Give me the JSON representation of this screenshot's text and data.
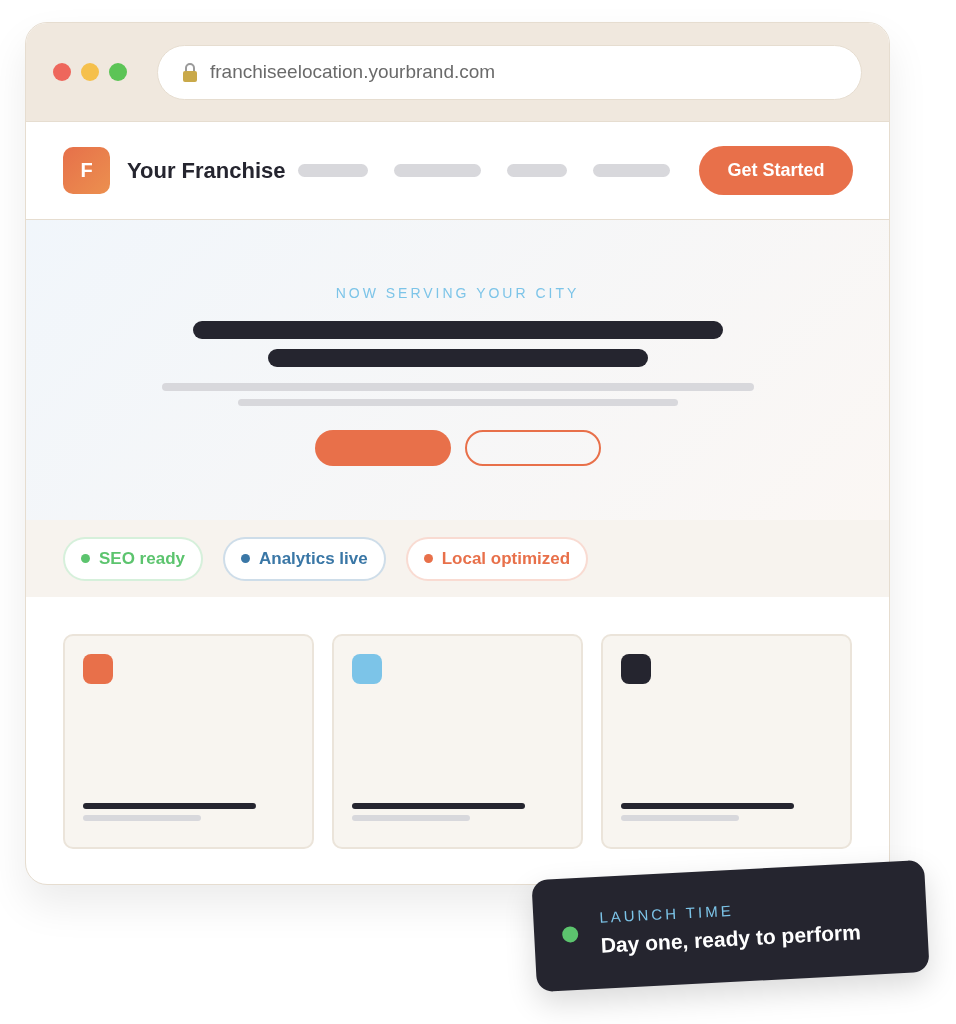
{
  "window": {
    "url": "franchiseelocation.yourbrand.com"
  },
  "nav": {
    "logo_letter": "F",
    "brand": "Your Franchise",
    "cta": "Get Started"
  },
  "hero": {
    "eyebrow": "NOW SERVING YOUR CITY"
  },
  "badges": [
    {
      "label": "SEO ready",
      "color": "#5cc46e"
    },
    {
      "label": "Analytics live",
      "color": "#3a77a6"
    },
    {
      "label": "Local optimized",
      "color": "#e8704a"
    }
  ],
  "cards": [
    {
      "color": "#e8704a"
    },
    {
      "color": "#7cc4e8"
    },
    {
      "color": "#25252f"
    }
  ],
  "toast": {
    "label": "LAUNCH TIME",
    "text": "Day one, ready to perform"
  }
}
